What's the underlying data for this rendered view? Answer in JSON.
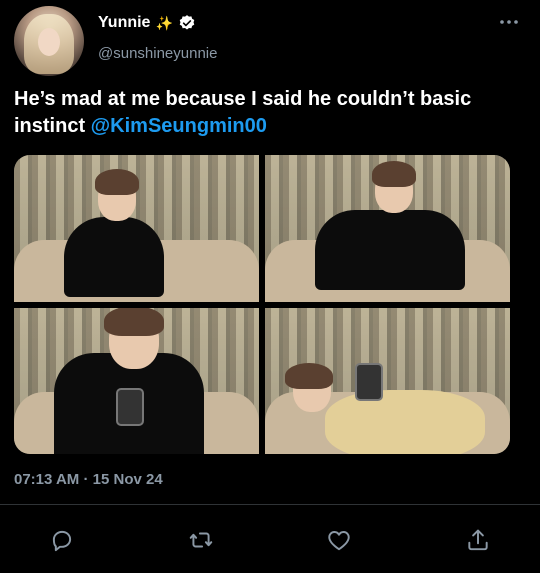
{
  "author": {
    "display_name": "Yunnie",
    "emoji": "✨",
    "handle": "@sunshineyunnie"
  },
  "tweet": {
    "text_before": "He’s mad at me because I said he couldn’t basic instinct ",
    "mention": "@KimSeungmin00"
  },
  "meta": {
    "timestamp": "07:13 AM · 15 Nov 24"
  },
  "colors": {
    "background": "#000000",
    "mention": "#1d9bf0",
    "muted": "#8b98a5"
  },
  "icons": {
    "more": "more-icon",
    "reply": "reply-icon",
    "retweet": "retweet-icon",
    "like": "heart-icon",
    "share": "share-icon"
  }
}
